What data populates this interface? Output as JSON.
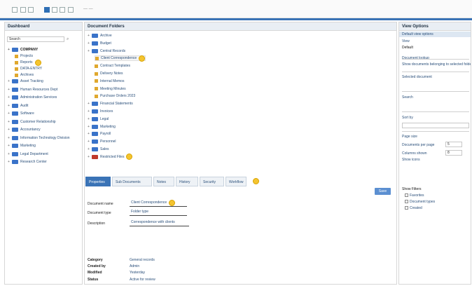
{
  "toolbar": {
    "text": "— —"
  },
  "left_panel": {
    "title": "Dashboard",
    "search_placeholder": "Search",
    "tree": [
      {
        "label": "COMPANY",
        "level": 0
      },
      {
        "label": "Projects",
        "level": 1
      },
      {
        "label": "Reports",
        "level": 1
      },
      {
        "label": "DATA-ENTRY",
        "level": 1
      },
      {
        "label": "Archives",
        "level": 1
      },
      {
        "label": "Asset Tracking",
        "level": 0
      },
      {
        "label": "Human Resources Dept",
        "level": 0
      },
      {
        "label": "Administration Services",
        "level": 0
      },
      {
        "label": "Audit",
        "level": 0
      },
      {
        "label": "Software",
        "level": 0
      },
      {
        "label": "Customer Relationship",
        "level": 0
      },
      {
        "label": "Accountancy",
        "level": 0
      },
      {
        "label": "Information Technology Division",
        "level": 0
      },
      {
        "label": "Marketing",
        "level": 0
      },
      {
        "label": "Legal Department",
        "level": 0
      },
      {
        "label": "Research Center",
        "level": 0
      }
    ]
  },
  "center_panel": {
    "title": "Document Folders",
    "tree": [
      {
        "label": "Archive",
        "level": 0,
        "type": "folder"
      },
      {
        "label": "Budget",
        "level": 0,
        "type": "folder"
      },
      {
        "label": "Central Records",
        "level": 0,
        "type": "folder"
      },
      {
        "label": "Client Correspondence",
        "level": 1,
        "type": "doc",
        "selected": true
      },
      {
        "label": "Contract Templates",
        "level": 1,
        "type": "doc"
      },
      {
        "label": "Delivery Notes",
        "level": 1,
        "type": "doc"
      },
      {
        "label": "Internal Memos",
        "level": 1,
        "type": "doc"
      },
      {
        "label": "Meeting Minutes",
        "level": 1,
        "type": "doc"
      },
      {
        "label": "Purchase Orders 2023",
        "level": 1,
        "type": "doc"
      },
      {
        "label": "Financial Statements",
        "level": 0,
        "type": "folder"
      },
      {
        "label": "Invoices",
        "level": 0,
        "type": "folder"
      },
      {
        "label": "Legal",
        "level": 0,
        "type": "folder"
      },
      {
        "label": "Marketing",
        "level": 0,
        "type": "folder"
      },
      {
        "label": "Payroll",
        "level": 0,
        "type": "folder"
      },
      {
        "label": "Personnel",
        "level": 0,
        "type": "folder"
      },
      {
        "label": "Sales",
        "level": 0,
        "type": "folder"
      },
      {
        "label": "Restricted Files",
        "level": 0,
        "type": "redfolder"
      }
    ]
  },
  "tabs": [
    "Properties",
    "Sub Documents",
    "Notes",
    "History",
    "Security",
    "Workflow"
  ],
  "save_label": "Save",
  "form": {
    "fields": [
      {
        "label": "Document name",
        "value": "Client Correspondence"
      },
      {
        "label": "Document type",
        "value": "Folder type"
      },
      {
        "label": "Description",
        "value": "Correspondence with clients"
      }
    ],
    "meta": [
      {
        "label": "Category",
        "value": "General records"
      },
      {
        "label": "Created by",
        "value": "Admin"
      },
      {
        "label": "Modified",
        "value": "Yesterday"
      },
      {
        "label": "Status",
        "value": "Active for review"
      }
    ]
  },
  "right_panel": {
    "title": "View Options",
    "subtitle": "Default view options",
    "items": [
      {
        "label": "View"
      },
      {
        "label": "Default"
      },
      {
        "label": "Document lookup"
      },
      {
        "label": "Show documents belonging to selected folder"
      },
      {
        "label": "Selected document"
      },
      {
        "label": "Search"
      },
      {
        "label": "Sort by"
      },
      {
        "label": "Name"
      },
      {
        "label": "Page size"
      },
      {
        "label": "Documents per page"
      },
      {
        "label": "Columns shown"
      },
      {
        "label": "Show icons"
      }
    ],
    "numbers": [
      "5",
      "8"
    ],
    "filters_title": "Show Filters",
    "filters": [
      "Favorites",
      "Document types",
      "Created"
    ]
  }
}
